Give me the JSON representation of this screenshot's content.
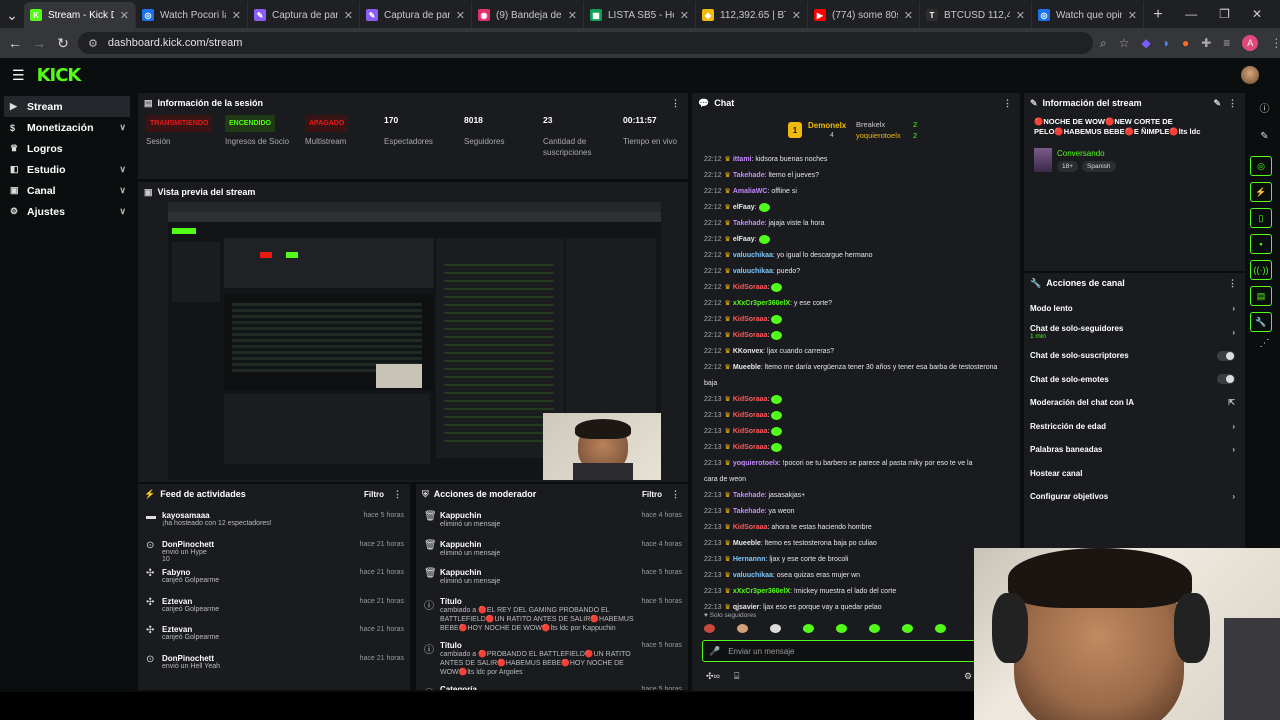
{
  "browser": {
    "tabs": [
      {
        "title": "Stream - Kick Da...",
        "color": "#53fc18",
        "glyph": "K",
        "active": true
      },
      {
        "title": "Watch Pocori la c...",
        "color": "#1a73e8",
        "glyph": "◎"
      },
      {
        "title": "Captura de panta...",
        "color": "#8b5cf6",
        "glyph": "✎"
      },
      {
        "title": "Captura de panta...",
        "color": "#8b5cf6",
        "glyph": "✎"
      },
      {
        "title": "(9) Bandeja de en...",
        "color": "#e1306c",
        "glyph": "◉"
      },
      {
        "title": "LISTA SB5 - Hojas...",
        "color": "#0f9d58",
        "glyph": "▦"
      },
      {
        "title": "112,392.65 | BTC...",
        "color": "#f0b90b",
        "glyph": "◆"
      },
      {
        "title": "(774) some 80s m...",
        "color": "#ff0000",
        "glyph": "▶"
      },
      {
        "title": "BTCUSD 112,401...",
        "color": "#2d2d2d",
        "glyph": "T"
      },
      {
        "title": "Watch que opina...",
        "color": "#1a73e8",
        "glyph": "◎"
      }
    ],
    "url": "dashboard.kick.com/stream",
    "profile_initial": "A"
  },
  "sidebar": {
    "items": [
      {
        "label": "Stream",
        "icon": "video-icon",
        "active": true
      },
      {
        "label": "Monetización",
        "icon": "money-icon",
        "chevron": true
      },
      {
        "label": "Logros",
        "icon": "trophy-icon"
      },
      {
        "label": "Estudio",
        "icon": "studio-icon",
        "chevron": true
      },
      {
        "label": "Canal",
        "icon": "channel-icon",
        "chevron": true
      },
      {
        "label": "Ajustes",
        "icon": "gear-icon",
        "chevron": true
      }
    ]
  },
  "session": {
    "title": "Información de la sesión",
    "stats": [
      {
        "badge": "TRANSMITIENDO",
        "badge_color": "#e91916",
        "label": "Sesión"
      },
      {
        "badge": "ENCENDIDO",
        "badge_color": "#53fc18",
        "label": "Ingresos de Socio"
      },
      {
        "badge": "APAGADO",
        "badge_color": "#e91916",
        "label": "Multistream"
      },
      {
        "value": "170",
        "label": "Espectadores"
      },
      {
        "value": "8018",
        "label": "Seguidores"
      },
      {
        "value": "23",
        "label": "Cantidad de suscripciones"
      },
      {
        "value": "00:11:57",
        "label": "Tiempo en vivo"
      }
    ]
  },
  "preview": {
    "title": "Vista previa del stream"
  },
  "activity": {
    "title": "Feed de actividades",
    "filter": "Filtro",
    "rows": [
      {
        "name": "kayosamaaa",
        "detail": "¡ha hosteado con 12 espectadores!",
        "time": "hace 5 horas",
        "icon": "host-icon"
      },
      {
        "name": "DonPinochett",
        "detail": "envió un Hype",
        "extra": "10",
        "time": "hace 21 horas",
        "icon": "kick-icon"
      },
      {
        "name": "Fabyno",
        "detail": "canjeó Golpearme",
        "time": "hace 21 horas",
        "icon": "redeem-icon"
      },
      {
        "name": "Eztevan",
        "detail": "canjeó Golpearme",
        "time": "hace 21 horas",
        "icon": "redeem-icon"
      },
      {
        "name": "Eztevan",
        "detail": "canjeó Golpearme",
        "time": "hace 21 horas",
        "icon": "redeem-icon"
      },
      {
        "name": "DonPinochett",
        "detail": "envió un Hell Yeah",
        "time": "hace 21 horas",
        "icon": "kick-icon"
      }
    ]
  },
  "modactions": {
    "title": "Acciones de moderador",
    "filter": "Filtro",
    "rows": [
      {
        "name": "Kappuchin",
        "detail": "eliminó un mensaje",
        "time": "hace 4 horas"
      },
      {
        "name": "Kappuchin",
        "detail": "eliminó un mensaje",
        "time": "hace 4 horas"
      },
      {
        "name": "Kappuchin",
        "detail": "eliminó un mensaje",
        "time": "hace 5 horas"
      },
      {
        "name": "Título",
        "detail": "cambiado a 🔴EL REY DEL GAMING PROBANDO EL BATTLEFIELD🔴UN RATITO ANTES DE SALIR🔴HABEMUS BEBE🔴HOY NOCHE DE WOW🔴lts ldc por Kappuchin",
        "time": "hace 5 horas"
      },
      {
        "name": "Título",
        "detail": "cambiado a 🔴PROBANDO EL BATTLEFIELD🔴UN RATITO ANTES DE SALIR🔴HABEMUS BEBE🔴HOY NOCHE DE WOW🔴lts ldc por Argoles",
        "time": "hace 5 horas"
      },
      {
        "name": "Categoría",
        "detail": "",
        "time": "hace 5 horas"
      }
    ]
  },
  "chat": {
    "title": "Chat",
    "top_gifters": [
      {
        "rank": "1",
        "name": "Demonelx",
        "count": "4"
      },
      {
        "name": "Breakelx",
        "count": "2"
      },
      {
        "name": "yoquierotoelx",
        "count": "2"
      }
    ],
    "messages": [
      {
        "time": "22:12",
        "user": "ittami",
        "color": "#c78bff",
        "text": "kidsora buenas noches"
      },
      {
        "time": "22:12",
        "user": "Takehade",
        "color": "#c78bff",
        "text": "ltemo el jueves?"
      },
      {
        "time": "22:12",
        "user": "AmaliaWC",
        "color": "#c78bff",
        "text": "offline si"
      },
      {
        "time": "22:12",
        "user": "elFaay",
        "color": "#e6e6e6",
        "text": "",
        "emote": true
      },
      {
        "time": "22:12",
        "user": "Takehade",
        "color": "#c78bff",
        "text": "jajaja viste la hora"
      },
      {
        "time": "22:12",
        "user": "elFaay",
        "color": "#e6e6e6",
        "text": "",
        "emote": true
      },
      {
        "time": "22:12",
        "user": "valuuchikaa",
        "color": "#7ec8ff",
        "text": "yo igual lo descargue hermano"
      },
      {
        "time": "22:12",
        "user": "valuuchikaa",
        "color": "#7ec8ff",
        "text": "puedo?"
      },
      {
        "time": "22:12",
        "user": "KidSoraaa",
        "color": "#ff5a5a",
        "text": "",
        "emote": true
      },
      {
        "time": "22:12",
        "user": "xXxCr3per360elX",
        "color": "#53fc18",
        "text": "y ese corte?"
      },
      {
        "time": "22:12",
        "user": "KidSoraaa",
        "color": "#ff5a5a",
        "text": "",
        "emote": true
      },
      {
        "time": "22:12",
        "user": "KidSoraaa",
        "color": "#ff5a5a",
        "text": "",
        "emote": true
      },
      {
        "time": "22:12",
        "user": "KKonvex",
        "color": "#e6e6e6",
        "text": "ljax cuando carreras?"
      },
      {
        "time": "22:12",
        "user": "Mueeble",
        "color": "#e6e6e6",
        "text": "ltemo me daría vergüenza tener 30 años y tener esa barba de testosterona"
      },
      {
        "time": "",
        "user": "",
        "color": "#e6e6e6",
        "text": "baja"
      },
      {
        "time": "22:13",
        "user": "KidSoraaa",
        "color": "#ff5a5a",
        "text": "",
        "emote": true
      },
      {
        "time": "22:13",
        "user": "KidSoraaa",
        "color": "#ff5a5a",
        "text": "",
        "emote": true
      },
      {
        "time": "22:13",
        "user": "KidSoraaa",
        "color": "#ff5a5a",
        "text": "",
        "emote": true
      },
      {
        "time": "22:13",
        "user": "KidSoraaa",
        "color": "#ff5a5a",
        "text": "",
        "emote": true
      },
      {
        "time": "22:13",
        "user": "yoquierotoelx",
        "color": "#c78bff",
        "text": "!pocori oe tu barbero se parece al pasta miky por eso te ve la"
      },
      {
        "time": "",
        "user": "",
        "color": "#e6e6e6",
        "text": "cara de weon"
      },
      {
        "time": "22:13",
        "user": "Takehade",
        "color": "#c78bff",
        "text": "jasasakjas+"
      },
      {
        "time": "22:13",
        "user": "Takehade",
        "color": "#c78bff",
        "text": "ya weon"
      },
      {
        "time": "22:13",
        "user": "KidSoraaa",
        "color": "#ff5a5a",
        "text": "ahora te estas haciendo hombre"
      },
      {
        "time": "22:13",
        "user": "Mueeble",
        "color": "#e6e6e6",
        "text": "ltemo es testosterona baja po culiao"
      },
      {
        "time": "22:13",
        "user": "Hernannn",
        "color": "#7ec8ff",
        "text": "ljax y ese corte de brocoli"
      },
      {
        "time": "22:13",
        "user": "valuuchikaa",
        "color": "#7ec8ff",
        "text": "osea quizas eras mujer wn"
      },
      {
        "time": "22:13",
        "user": "xXxCr3per360elX",
        "color": "#53fc18",
        "text": "!mickey muestra el lado del corte"
      },
      {
        "time": "22:13",
        "user": "qjsavier",
        "color": "#e6e6e6",
        "text": "ljax eso es porque vay a quedar pelao"
      }
    ],
    "followers_only": "Solo seguidores",
    "input_placeholder": "Enviar un mensaje"
  },
  "stream_info": {
    "title": "Información del stream",
    "stream_title": "🔴NOCHE DE WOW🔴NEW CORTE DE PELO🔴HABEMUS BEBE🔴E ÑIMPLE🔴lts ldc",
    "category": "Conversando",
    "tags": [
      "18+",
      "Spanish"
    ]
  },
  "channel_actions": {
    "title": "Acciones de canal",
    "rows": [
      {
        "label": "Modo lento",
        "control": "chevron"
      },
      {
        "label": "Chat de solo-seguidores",
        "sub": "1 min",
        "control": "chevron"
      },
      {
        "label": "Chat de solo-suscriptores",
        "control": "toggle"
      },
      {
        "label": "Chat de solo-emotes",
        "control": "toggle"
      },
      {
        "label": "Moderación del chat con IA",
        "control": "external"
      },
      {
        "label": "Restricción de edad",
        "control": "chevron"
      },
      {
        "label": "Palabras baneadas",
        "control": "chevron"
      },
      {
        "label": "Hostear canal",
        "control": "none"
      },
      {
        "label": "Configurar objetivos",
        "control": "chevron"
      }
    ]
  }
}
